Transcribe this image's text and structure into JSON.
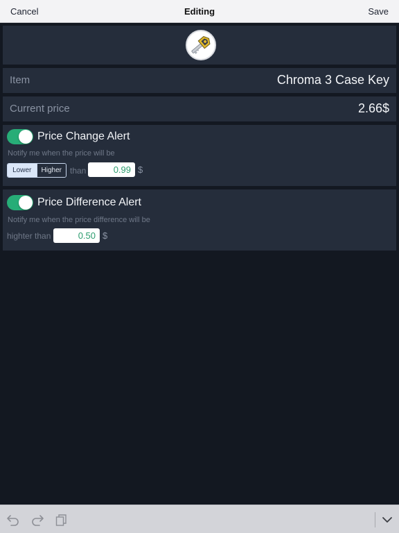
{
  "navbar": {
    "cancel_label": "Cancel",
    "title": "Editing",
    "save_label": "Save"
  },
  "item_icon": "key-item-icon",
  "item_row": {
    "label": "Item",
    "value": "Chroma 3 Case Key"
  },
  "price_row": {
    "label": "Current price",
    "value": "2.66$"
  },
  "price_change_alert": {
    "enabled": true,
    "title": "Price Change Alert",
    "description": "Notify me when the price will be",
    "options": [
      "Lower",
      "Higher"
    ],
    "selected": "Lower",
    "connector": "than",
    "value": "0.99",
    "currency": "$"
  },
  "price_difference_alert": {
    "enabled": true,
    "title": "Price Difference Alert",
    "description": "Notify me when the price difference will be",
    "connector": "highter than",
    "value": "0.50",
    "currency": "$"
  },
  "toolbar": {
    "undo_icon": "undo-icon",
    "redo_icon": "redo-icon",
    "clipboard_icon": "clipboard-icon",
    "dismiss_icon": "chevron-down-icon"
  },
  "colors": {
    "background": "#131821",
    "panel": "#252d3b",
    "toggle_on": "#27ad77",
    "value_text": "#2b9c6e"
  }
}
